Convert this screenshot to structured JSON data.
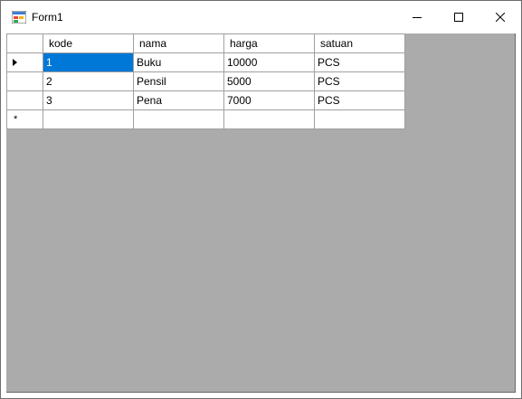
{
  "window": {
    "title": "Form1"
  },
  "grid": {
    "columns": [
      "kode",
      "nama",
      "harga",
      "satuan"
    ],
    "rows": [
      [
        "1",
        "Buku",
        "10000",
        "PCS"
      ],
      [
        "2",
        "Pensil",
        "5000",
        "PCS"
      ],
      [
        "3",
        "Pena",
        "7000",
        "PCS"
      ]
    ],
    "new_row_marker": "*",
    "current_row_icon": "row-indicator-arrow-icon"
  },
  "colors": {
    "selection": "#0078d7",
    "background_area": "#ababab",
    "grid_line": "#a0a0a0"
  }
}
